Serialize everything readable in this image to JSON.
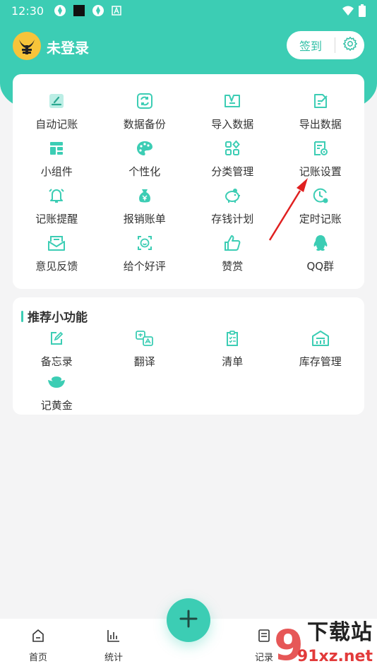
{
  "status_bar": {
    "time": "12:30"
  },
  "header": {
    "username": "未登录",
    "checkin_label": "签到"
  },
  "features": [
    {
      "label": "自动记账",
      "icon": "auto-bookkeeping-icon"
    },
    {
      "label": "数据备份",
      "icon": "data-backup-icon"
    },
    {
      "label": "导入数据",
      "icon": "import-data-icon"
    },
    {
      "label": "导出数据",
      "icon": "export-data-icon"
    },
    {
      "label": "小组件",
      "icon": "widget-icon"
    },
    {
      "label": "个性化",
      "icon": "palette-icon"
    },
    {
      "label": "分类管理",
      "icon": "category-icon"
    },
    {
      "label": "记账设置",
      "icon": "bookkeeping-settings-icon"
    },
    {
      "label": "记账提醒",
      "icon": "bell-icon"
    },
    {
      "label": "报销账单",
      "icon": "money-bag-icon"
    },
    {
      "label": "存钱计划",
      "icon": "piggy-bank-icon"
    },
    {
      "label": "定时记账",
      "icon": "clock-icon"
    },
    {
      "label": "意见反馈",
      "icon": "mail-icon"
    },
    {
      "label": "给个好评",
      "icon": "smile-icon"
    },
    {
      "label": "赞赏",
      "icon": "thumbs-up-icon"
    },
    {
      "label": "QQ群",
      "icon": "qq-icon"
    }
  ],
  "recommended": {
    "title": "推荐小功能",
    "items": [
      {
        "label": "备忘录",
        "icon": "memo-icon"
      },
      {
        "label": "翻译",
        "icon": "translate-icon"
      },
      {
        "label": "清单",
        "icon": "checklist-icon"
      },
      {
        "label": "库存管理",
        "icon": "warehouse-icon"
      },
      {
        "label": "记黄金",
        "icon": "gold-ingot-icon"
      }
    ]
  },
  "bottom_nav": {
    "home": "首页",
    "stats": "统计",
    "records": "记录"
  },
  "watermark": {
    "text": "下载站",
    "url": "91xz.net"
  },
  "colors": {
    "accent": "#3ccdb4",
    "arrow": "#e02020"
  }
}
